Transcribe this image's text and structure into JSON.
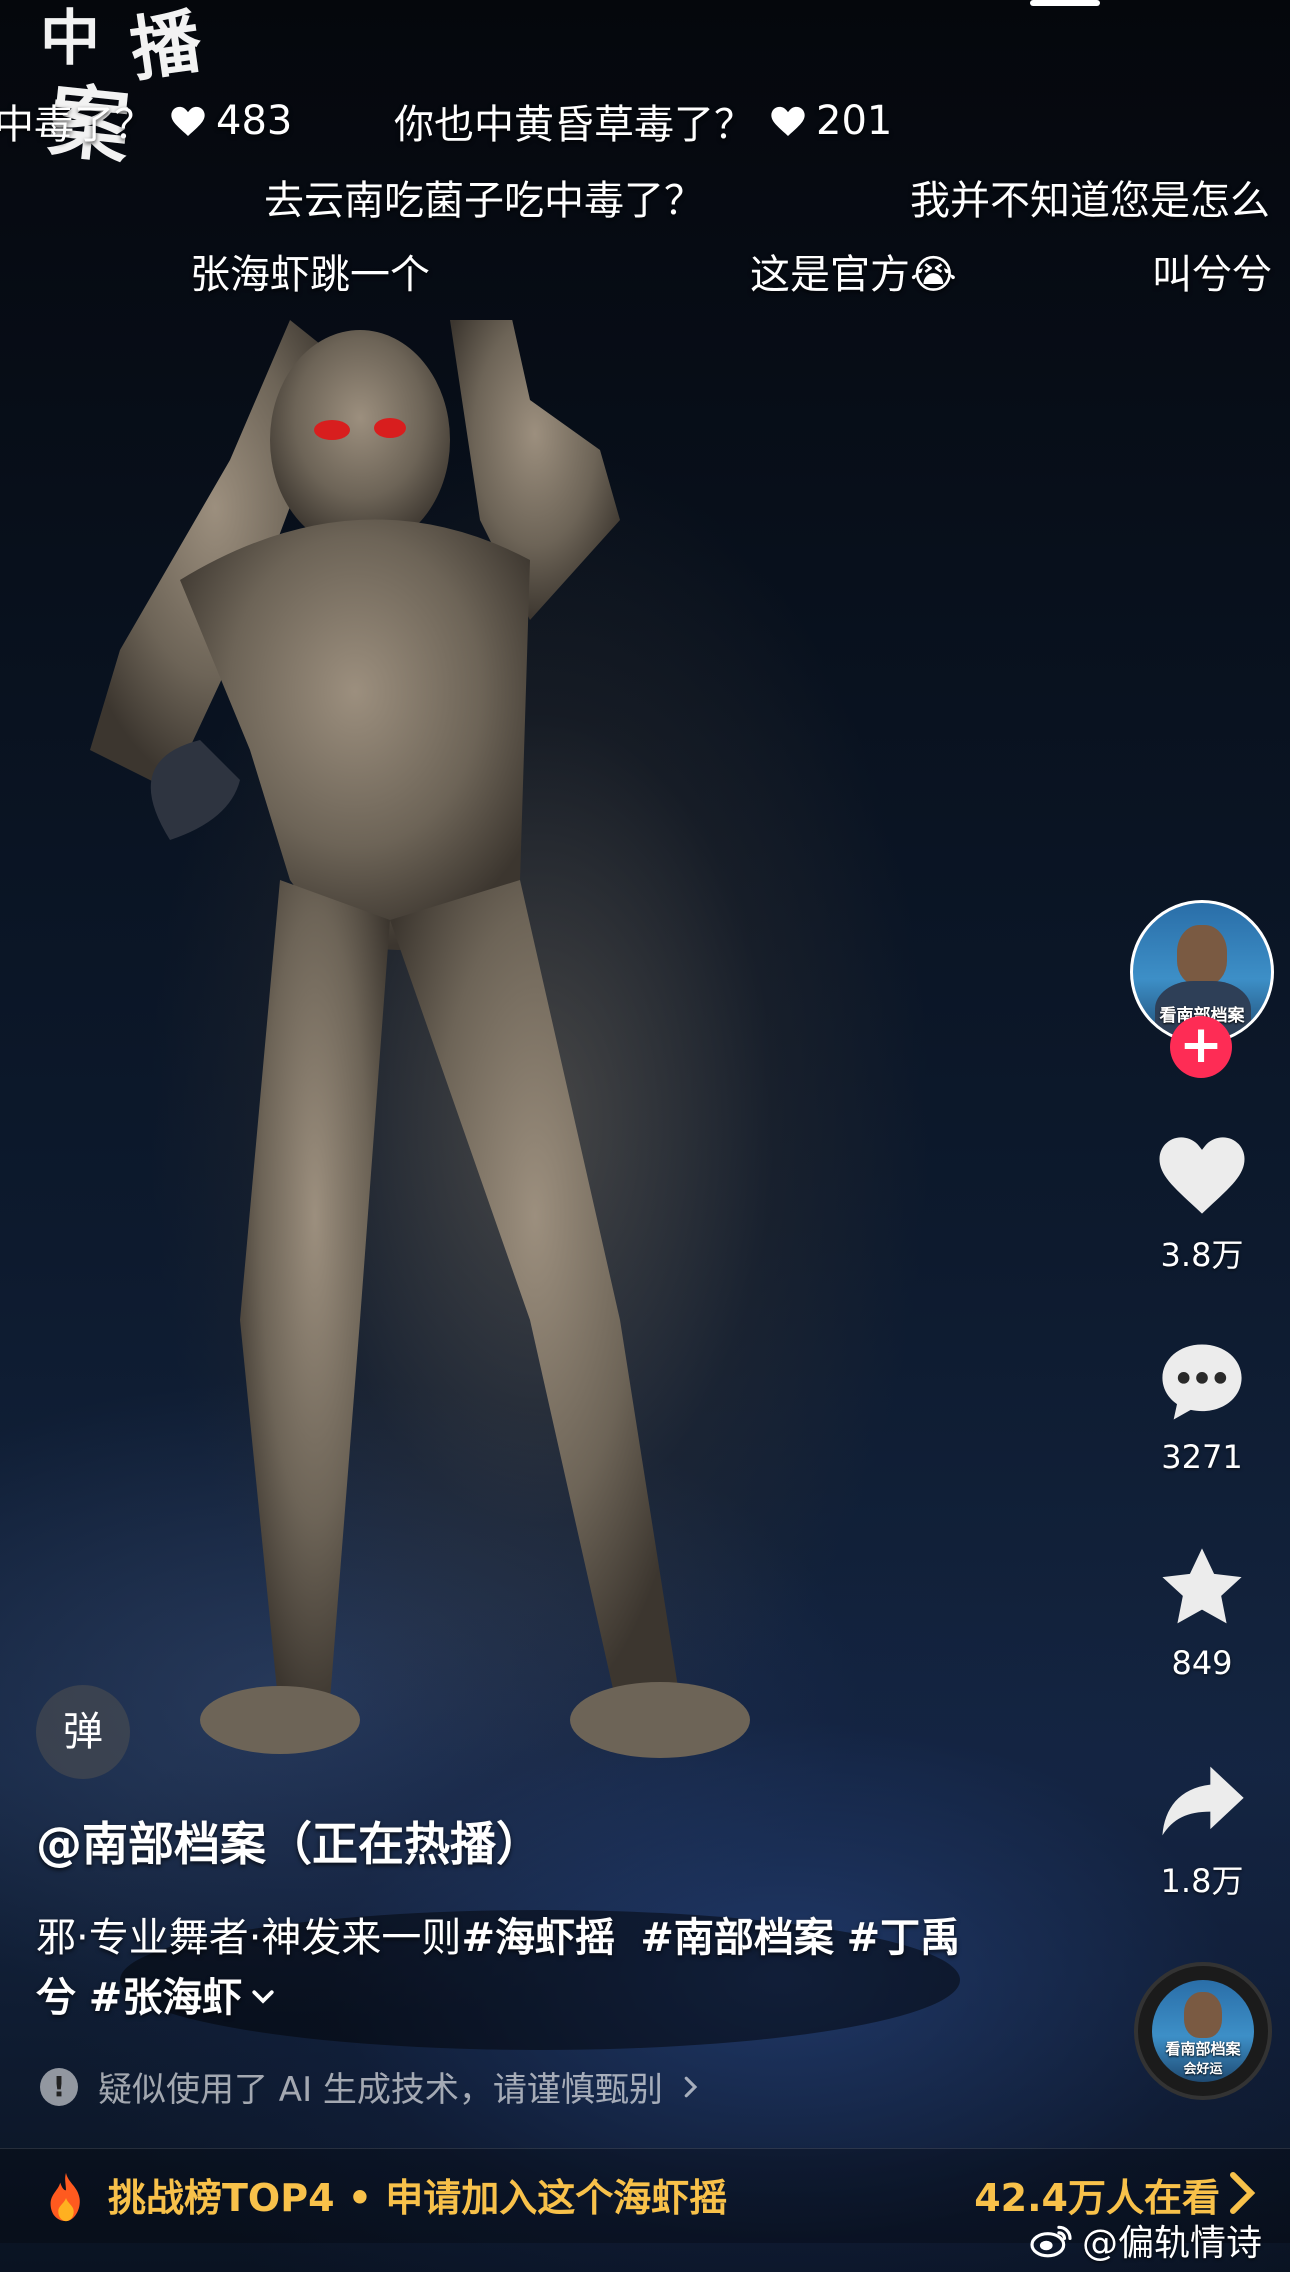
{
  "logo": {
    "chars": [
      "中",
      "播",
      "案"
    ]
  },
  "danmaku": {
    "row1": [
      {
        "text": "中毒了？",
        "likes": "483"
      },
      {
        "text": "你也中黄昏草毒了？",
        "likes": "201"
      }
    ],
    "row2": [
      "去云南吃菌子吃中毒了？",
      "我并不知道您是怎么"
    ],
    "row3": [
      "张海虾跳一个",
      "这是官方😭",
      "叫兮兮"
    ]
  },
  "rail": {
    "avatar_caption": "看南部档案",
    "follow_symbol": "+",
    "like_count": "3.8万",
    "comment_count": "3271",
    "favorite_count": "849",
    "share_count": "1.8万",
    "music_line1": "看南部档案",
    "music_line2": "会好运"
  },
  "danmaku_toggle": "弹",
  "post": {
    "author": "@南部档案（正在热播）",
    "desc_text": "邪·专业舞者·神发来一则",
    "tags": [
      "#海虾摇",
      "#南部档案",
      "#丁禹兮",
      "#张海虾"
    ],
    "ai_notice": "疑似使用了 AI 生成技术，请谨慎甄别"
  },
  "banner": {
    "left_text": "挑战榜TOP4 • 申请加入这个海虾摇",
    "right_text": "42.4万人在看"
  },
  "watermark": "@偏轨情诗",
  "colors": {
    "accent_pink": "#fe2c55",
    "banner_gold": "#f8c14a"
  },
  "icons": [
    "heart-icon",
    "comment-icon",
    "star-icon",
    "share-icon",
    "fire-icon",
    "weibo-icon",
    "info-icon",
    "chevron-right-icon",
    "chevron-down-icon"
  ]
}
